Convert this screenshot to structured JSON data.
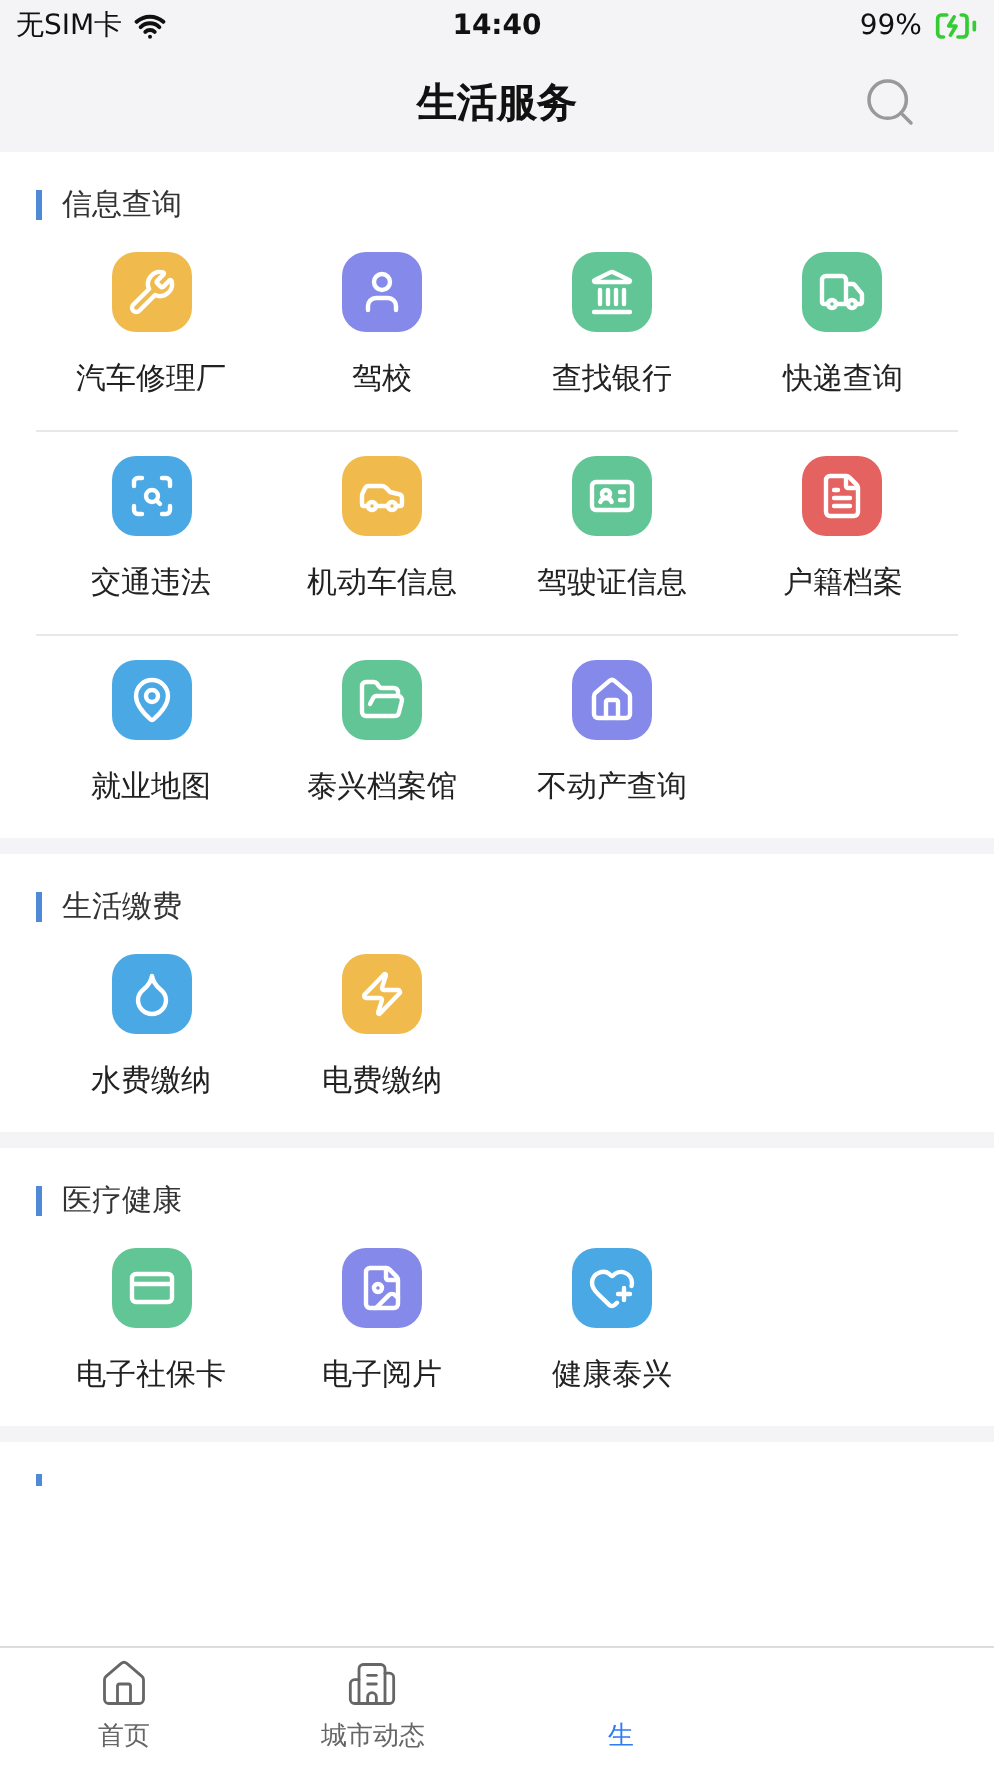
{
  "status_bar": {
    "carrier": "无SIM卡",
    "time": "14:40",
    "battery": "99%"
  },
  "nav": {
    "title": "生活服务"
  },
  "sections": [
    {
      "title": "信息查询",
      "items": [
        {
          "label": "汽车修理厂",
          "color": "#f0bb4c"
        },
        {
          "label": "驾校",
          "color": "#8489ea"
        },
        {
          "label": "查找银行",
          "color": "#62c595"
        },
        {
          "label": "快递查询",
          "color": "#62c595"
        },
        {
          "label": "交通违法",
          "color": "#4aa8e4"
        },
        {
          "label": "机动车信息",
          "color": "#f0bb4c"
        },
        {
          "label": "驾驶证信息",
          "color": "#62c595"
        },
        {
          "label": "户籍档案",
          "color": "#e4625f"
        },
        {
          "label": "就业地图",
          "color": "#4aa8e4"
        },
        {
          "label": "泰兴档案馆",
          "color": "#62c595"
        },
        {
          "label": "不动产查询",
          "color": "#8489ea"
        }
      ]
    },
    {
      "title": "生活缴费",
      "items": [
        {
          "label": "水费缴纳",
          "color": "#4aa8e4"
        },
        {
          "label": "电费缴纳",
          "color": "#f0bb4c"
        }
      ]
    },
    {
      "title": "医疗健康",
      "items": [
        {
          "label": "电子社保卡",
          "color": "#62c595"
        },
        {
          "label": "电子阅片",
          "color": "#8489ea"
        },
        {
          "label": "健康泰兴",
          "color": "#4aa8e4"
        }
      ]
    }
  ],
  "tab_bar": [
    {
      "label": "首页",
      "selected": false
    },
    {
      "label": "城市动态",
      "selected": false
    },
    {
      "label": "生",
      "selected": true
    }
  ]
}
